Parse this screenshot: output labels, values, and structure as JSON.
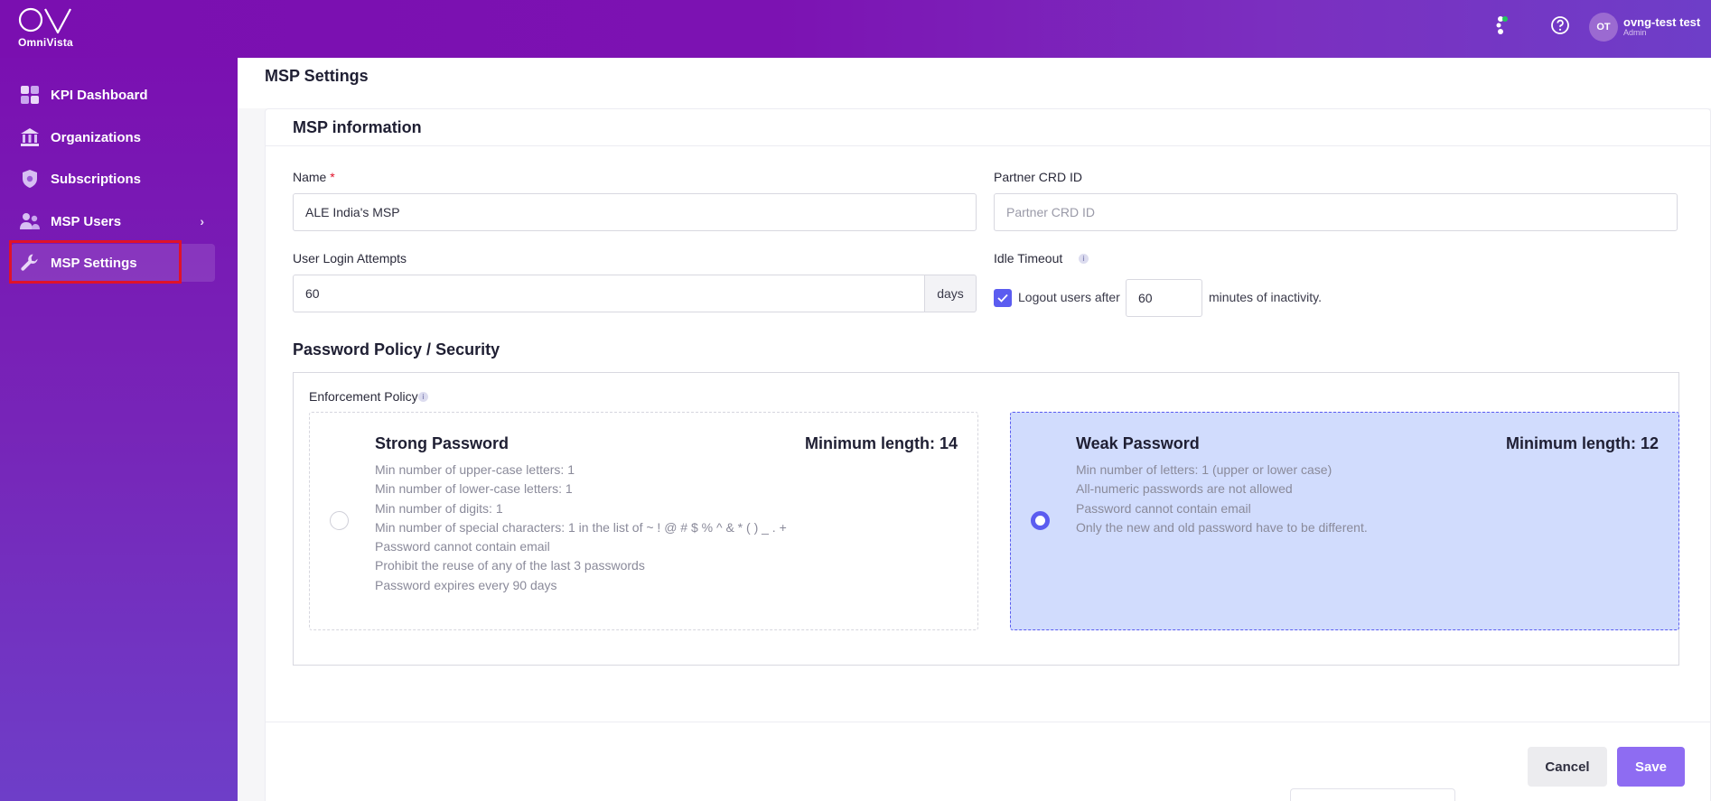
{
  "app": {
    "logo_text": "OmniVista",
    "user": {
      "initials": "OT",
      "name": "ovng-test test",
      "role": "Admin"
    }
  },
  "sidebar": {
    "items": [
      {
        "label": "KPI Dashboard",
        "icon": "dashboard-icon"
      },
      {
        "label": "Organizations",
        "icon": "bank-icon"
      },
      {
        "label": "Subscriptions",
        "icon": "shield-icon"
      },
      {
        "label": "MSP Users",
        "icon": "users-icon",
        "has_chevron": true
      },
      {
        "label": "MSP Settings",
        "icon": "wrench-icon",
        "active": true
      }
    ]
  },
  "page": {
    "title": "MSP Settings",
    "section_info_title": "MSP information",
    "fields": {
      "name": {
        "label": "Name",
        "required_mark": "*",
        "value": "ALE India's MSP"
      },
      "partner_crd": {
        "label": "Partner CRD ID",
        "value": "",
        "placeholder": "Partner CRD ID"
      },
      "login_attempts": {
        "label": "User Login Attempts",
        "value": "60",
        "addon": "days"
      },
      "idle_timeout": {
        "label": "Idle Timeout",
        "checkbox_checked": true,
        "prefix": "Logout users after",
        "value": "60",
        "suffix": "minutes of inactivity."
      }
    },
    "password_section_title": "Password Policy / Security",
    "enforcement_label": "Enforcement Policy",
    "policies": [
      {
        "title": "Strong Password",
        "min_length": "Minimum length: 14",
        "selected": false,
        "rules": [
          "Min number of upper-case letters: 1",
          "Min number of lower-case letters: 1",
          "Min number of digits: 1",
          "Min number of special characters: 1 in the list of ~ ! @ # $ % ^ & * ( ) _ . +",
          "Password cannot contain email",
          "Prohibit the reuse of any of the last 3 passwords",
          "Password expires every 90 days"
        ]
      },
      {
        "title": "Weak Password",
        "min_length": "Minimum length: 12",
        "selected": true,
        "rules": [
          "Min number of letters: 1 (upper or lower case)",
          "All-numeric passwords are not allowed",
          "Password cannot contain email",
          "Only the new and old password have to be different."
        ]
      }
    ],
    "buttons": {
      "cancel": "Cancel",
      "save": "Save"
    }
  },
  "colors": {
    "accent": "#5b5cf0",
    "save_button": "#8e6cf2",
    "selected_card": "#d1dcfd",
    "highlight": "#e0122a",
    "sidebar": "#7a10b1"
  }
}
